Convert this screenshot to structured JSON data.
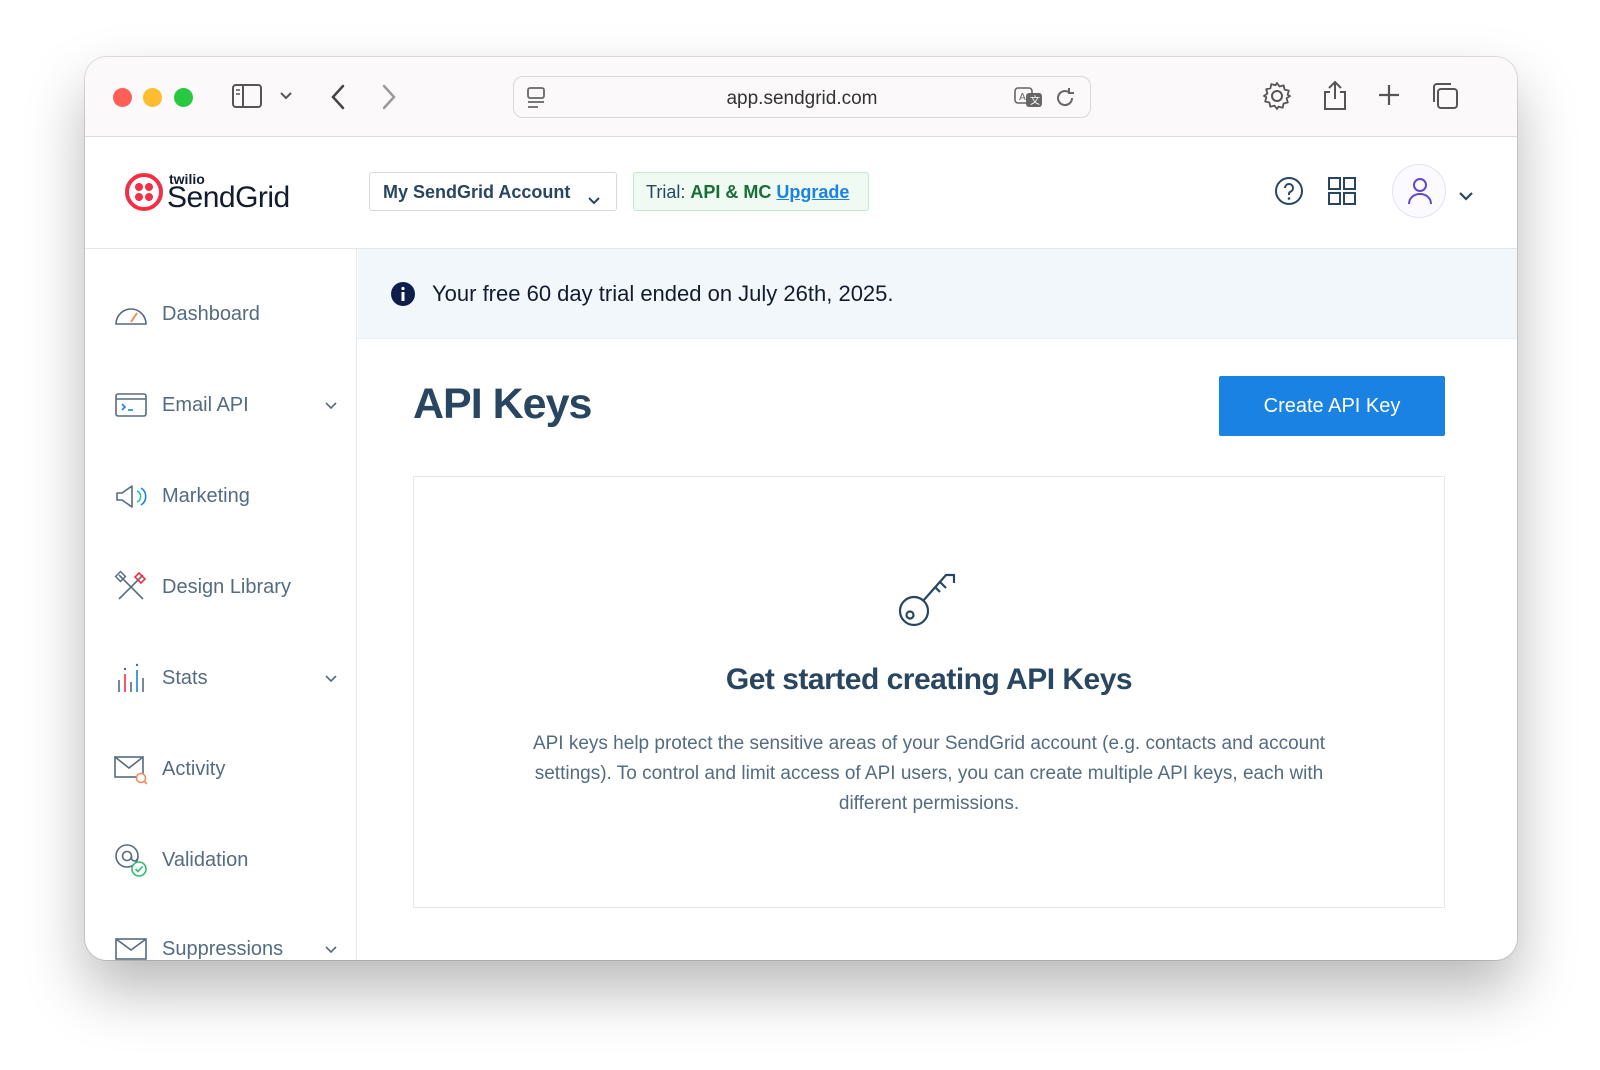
{
  "browser": {
    "url": "app.sendgrid.com",
    "icons": [
      "sidebar-toggle-icon",
      "chevron-down-icon",
      "back-icon",
      "forward-icon",
      "page-menu-icon",
      "translate-icon",
      "reload-icon",
      "settings-gear-icon",
      "share-icon",
      "new-tab-icon",
      "tab-overview-icon"
    ]
  },
  "header": {
    "logo_small": "twilio",
    "logo_main": "SendGrid",
    "account_select": "My SendGrid Account",
    "trial_prefix": "Trial:",
    "trial_plan": "API & MC",
    "trial_upgrade": "Upgrade",
    "icons": [
      "help-icon",
      "apps-grid-icon",
      "user-icon",
      "chevron-down-icon"
    ]
  },
  "sidebar": {
    "items": [
      {
        "label": "Dashboard",
        "icon": "dashboard-gauge-icon",
        "expandable": false
      },
      {
        "label": "Email API",
        "icon": "terminal-window-icon",
        "expandable": true
      },
      {
        "label": "Marketing",
        "icon": "megaphone-icon",
        "expandable": false
      },
      {
        "label": "Design Library",
        "icon": "design-tools-icon",
        "expandable": false
      },
      {
        "label": "Stats",
        "icon": "bar-chart-icon",
        "expandable": true
      },
      {
        "label": "Activity",
        "icon": "envelope-search-icon",
        "expandable": false
      },
      {
        "label": "Validation",
        "icon": "at-check-icon",
        "expandable": false
      },
      {
        "label": "Suppressions",
        "icon": "envelope-icon",
        "expandable": true
      }
    ]
  },
  "banner": {
    "text": "Your free 60 day trial ended on July 26th, 2025.",
    "icon": "info-icon"
  },
  "main": {
    "title": "API Keys",
    "create_button": "Create API Key",
    "empty_title": "Get started creating API Keys",
    "empty_description": "API keys help protect the sensitive areas of your SendGrid account (e.g. contacts and account settings). To control and limit access of API users, you can create multiple API keys, each with different permissions.",
    "empty_icon": "key-icon"
  },
  "colors": {
    "primary": "#1a82e2",
    "heading": "#294661",
    "text_muted": "#546b81",
    "banner_bg": "#f2f7fc",
    "trial_bg": "#eefaf2",
    "logo_red": "#f22f46"
  }
}
